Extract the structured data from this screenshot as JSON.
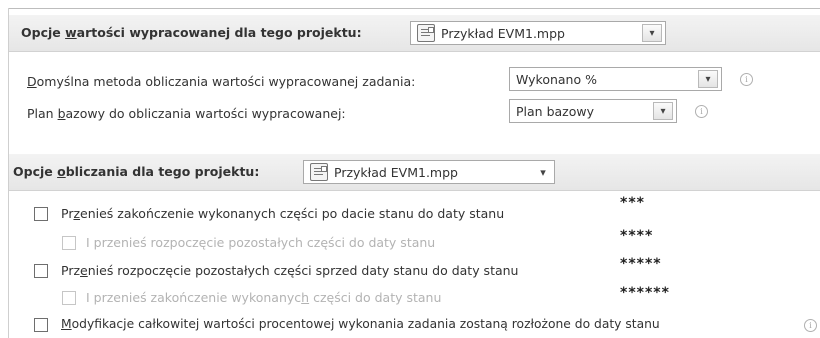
{
  "earned_value_section": {
    "heading_pre": "Opcje ",
    "heading_key": "w",
    "heading_post": "artości wypracowanej dla tego projektu:",
    "project_select": {
      "value": "Przykład EVM1.mpp"
    },
    "default_method": {
      "label_key": "D",
      "label_post": "omyślna metoda obliczania wartości wypracowanej zadania:",
      "value": "Wykonano %"
    },
    "baseline": {
      "label_pre": "Plan ",
      "label_key": "b",
      "label_post": "azowy do obliczania wartości wypracowanej:",
      "value": "Plan bazowy"
    }
  },
  "calculation_section": {
    "heading_pre": "Opcje ",
    "heading_key": "o",
    "heading_post": "bliczania dla tego projektu:",
    "project_select": {
      "value": "Przykład EVM1.mpp"
    },
    "options": [
      {
        "pre": "Pr",
        "key": "z",
        "post": "enieś zakończenie wykonanych części po dacie stanu do daty stanu",
        "stars": "***",
        "enabled": true
      },
      {
        "pre": "I przenieś rozpoczęcie pozostałych części do daty stanu",
        "key": "",
        "post": "",
        "stars": "****",
        "enabled": false
      },
      {
        "pre": "Prz",
        "key": "e",
        "post": "nieś rozpoczęcie pozostałych części sprzed daty stanu do daty stanu",
        "stars": "*****",
        "enabled": true
      },
      {
        "pre": "I przenieś zakończenie wykonanyc",
        "key": "h",
        "post": " części do daty stanu",
        "stars": "******",
        "enabled": false
      },
      {
        "pre": "",
        "key": "M",
        "post": "odyfikacje całkowitej wartości procentowej wykonania zadania zostaną rozłożone do daty stanu",
        "stars": "",
        "enabled": true
      }
    ]
  },
  "colors": {
    "header_bg": "#eaeaea",
    "border": "#a9a9a9",
    "disabled_text": "#b3b3b3"
  },
  "icons": {
    "info": "info-icon",
    "file": "project-file-icon",
    "dropdown": "chevron-down-icon"
  },
  "glyphs": {
    "info": "i",
    "dropdown": "▾"
  }
}
